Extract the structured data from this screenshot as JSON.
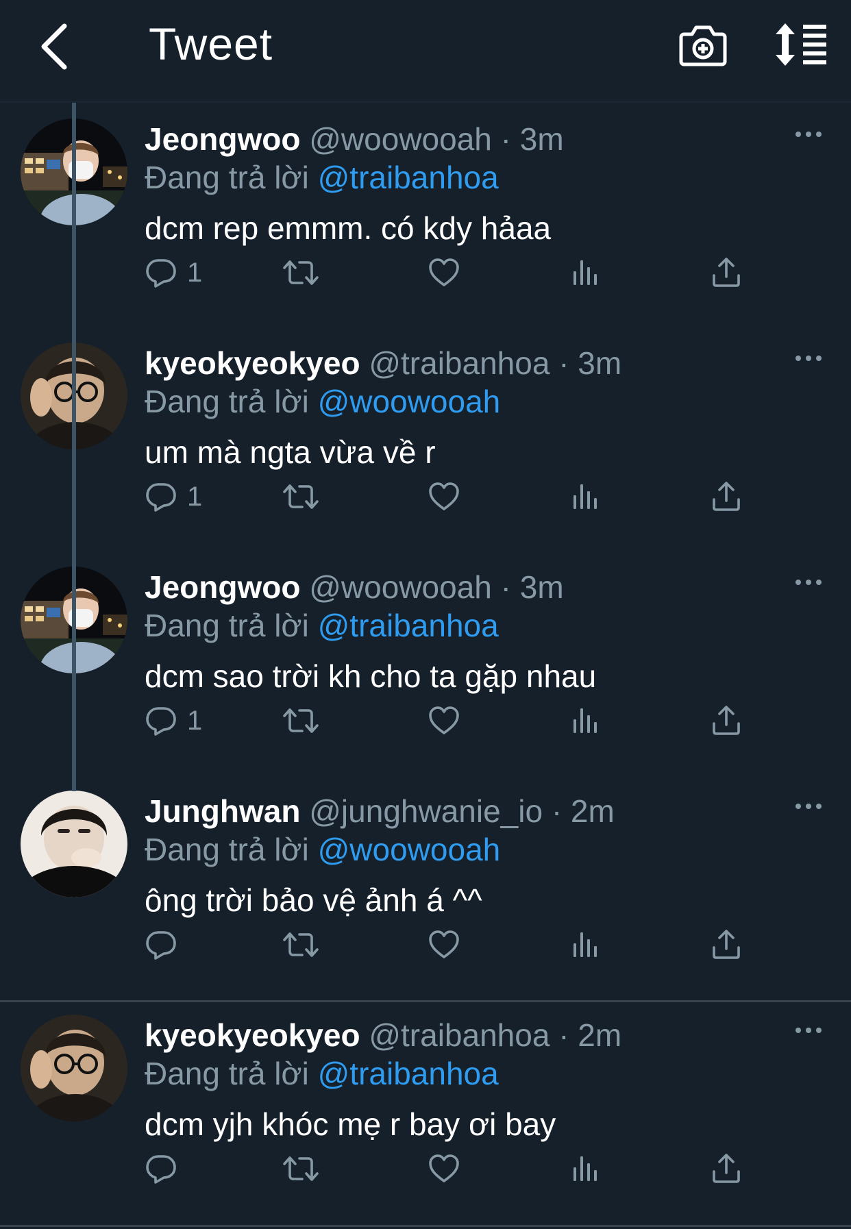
{
  "header": {
    "title": "Tweet"
  },
  "colors": {
    "background": "#15202b",
    "secondary_text": "#8899a6",
    "mention": "#2f9cf0",
    "thread_line": "#3d5466"
  },
  "tweets": [
    {
      "display_name": "Jeongwoo",
      "handle_time": "@woowooah · 3m",
      "reply_prefix": "Đang trả lời",
      "reply_to": "@traibanhoa",
      "text": "dcm rep emmm. có kdy hảaa",
      "reply_count": "1",
      "avatar": "avatar-jeongwoo"
    },
    {
      "display_name": "kyeokyeokyeo",
      "handle_time": "@traibanhoa · 3m",
      "reply_prefix": "Đang trả lời",
      "reply_to": "@woowooah",
      "text": "um mà ngta vừa về r",
      "reply_count": "1",
      "avatar": "avatar-kyeokyeokyeo"
    },
    {
      "display_name": "Jeongwoo",
      "handle_time": "@woowooah · 3m",
      "reply_prefix": "Đang trả lời",
      "reply_to": "@traibanhoa",
      "text": "dcm sao trời kh cho ta gặp nhau",
      "reply_count": "1",
      "avatar": "avatar-jeongwoo"
    },
    {
      "display_name": "Junghwan",
      "handle_time": "@junghwanie_io · 2m",
      "reply_prefix": "Đang trả lời",
      "reply_to": "@woowooah",
      "text": "ông trời bảo vệ ảnh á ^^",
      "reply_count": "",
      "avatar": "avatar-junghwan"
    },
    {
      "display_name": "kyeokyeokyeo",
      "handle_time": "@traibanhoa · 2m",
      "reply_prefix": "Đang trả lời",
      "reply_to": "@traibanhoa",
      "text": "dcm yjh khóc mẹ r bay ơi bay",
      "reply_count": "",
      "avatar": "avatar-kyeokyeokyeo"
    }
  ]
}
